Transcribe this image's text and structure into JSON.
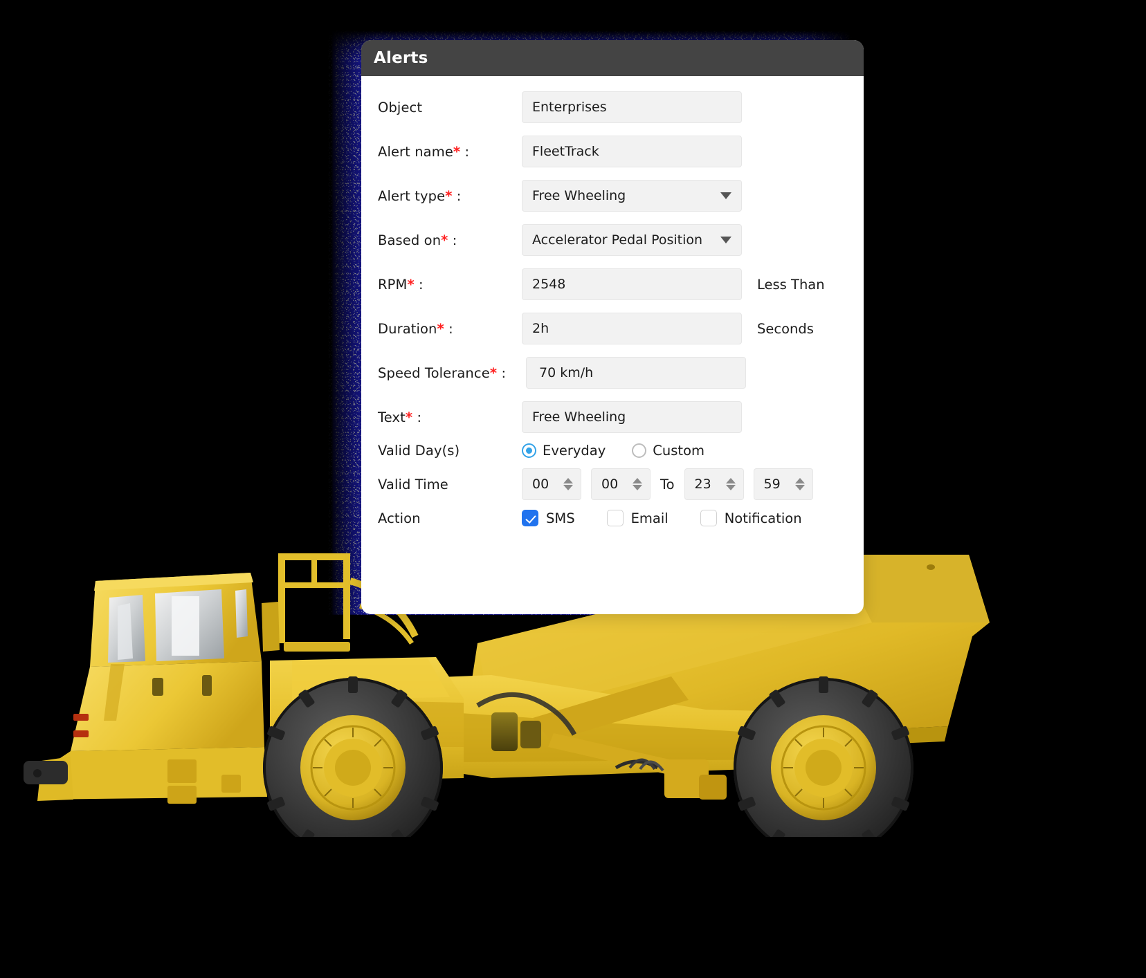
{
  "card": {
    "title": "Alerts"
  },
  "form": {
    "object": {
      "label": "Object",
      "value": "Enterprises"
    },
    "alert_name": {
      "label": "Alert name",
      "required": "*",
      "colon": " :",
      "value": "FleetTrack"
    },
    "alert_type": {
      "label": "Alert type",
      "required": "*",
      "colon": " :",
      "value": "Free Wheeling",
      "icon": "chevron-down-icon"
    },
    "based_on": {
      "label": "Based on",
      "required": "*",
      "colon": " :",
      "value": "Accelerator Pedal Position",
      "icon": "chevron-down-icon"
    },
    "rpm": {
      "label": "RPM",
      "required": "*",
      "colon": " :",
      "value": "2548",
      "suffix": "Less Than"
    },
    "duration": {
      "label": "Duration",
      "required": "*",
      "colon": " :",
      "value": "2h",
      "suffix": "Seconds"
    },
    "speed_tolerance": {
      "label": "Speed Tolerance",
      "required": "*",
      "colon": " :",
      "value": "70 km/h"
    },
    "text": {
      "label": "Text",
      "required": "*",
      "colon": " :",
      "value": "Free Wheeling"
    },
    "valid_days": {
      "label": "Valid Day(s)",
      "options": [
        {
          "label": "Everyday",
          "selected": true
        },
        {
          "label": "Custom",
          "selected": false
        }
      ]
    },
    "valid_time": {
      "label": "Valid Time",
      "from_hour": "00",
      "from_minute": "00",
      "separator": "To",
      "to_hour": "23",
      "to_minute": "59"
    },
    "action": {
      "label": "Action",
      "options": [
        {
          "label": "SMS",
          "checked": true
        },
        {
          "label": "Email",
          "checked": false
        },
        {
          "label": "Notification",
          "checked": false
        }
      ]
    }
  },
  "colors": {
    "header_bg": "#444444",
    "glow": "#1f1fc8",
    "accent_checkbox": "#2173ee",
    "accent_radio": "#34a3e8",
    "required_star": "#ff2020",
    "field_bg": "#f2f2f2",
    "truck_yellow": "#e8c22e"
  }
}
